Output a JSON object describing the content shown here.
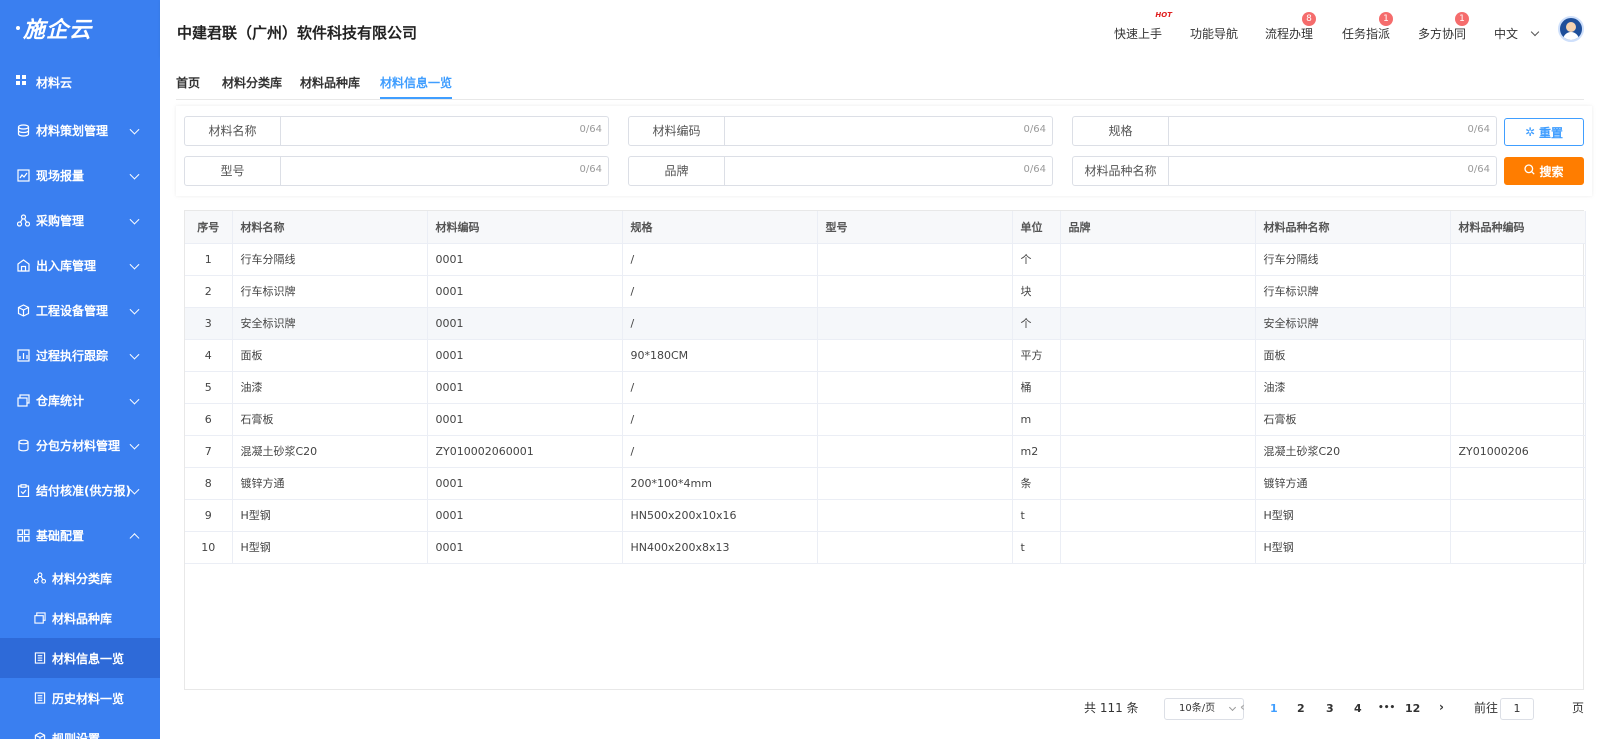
{
  "app": {
    "logo": "施企云"
  },
  "sidebar": {
    "root": "材料云",
    "items": [
      {
        "label": "材料策划管理",
        "icon": "database-icon"
      },
      {
        "label": "现场报量",
        "icon": "report-icon"
      },
      {
        "label": "采购管理",
        "icon": "network-icon"
      },
      {
        "label": "出入库管理",
        "icon": "warehouse-icon"
      },
      {
        "label": "工程设备管理",
        "icon": "cube-icon"
      },
      {
        "label": "过程执行跟踪",
        "icon": "chart-icon"
      },
      {
        "label": "仓库统计",
        "icon": "stack-icon"
      },
      {
        "label": "分包方材料管理",
        "icon": "coins-icon"
      },
      {
        "label": "结付核准(供方报)",
        "icon": "clipboard-icon"
      },
      {
        "label": "基础配置",
        "icon": "grid-icon"
      }
    ],
    "sub_items": [
      {
        "label": "材料分类库",
        "icon": "network-icon"
      },
      {
        "label": "材料品种库",
        "icon": "stack-icon"
      },
      {
        "label": "材料信息一览",
        "icon": "document-icon"
      },
      {
        "label": "历史材料一览",
        "icon": "document-icon"
      },
      {
        "label": "规则设置",
        "icon": "cube-icon"
      }
    ]
  },
  "header": {
    "company": "中建君联（广州）软件科技有限公司",
    "nav": [
      {
        "label": "快速上手",
        "badge": "HOT"
      },
      {
        "label": "功能导航",
        "badge": ""
      },
      {
        "label": "流程办理",
        "badge": "8"
      },
      {
        "label": "任务指派",
        "badge": "1"
      },
      {
        "label": "多方协同",
        "badge": "1"
      }
    ],
    "language": "中文"
  },
  "tabs": [
    "首页",
    "材料分类库",
    "材料品种库",
    "材料信息一览"
  ],
  "filters": [
    {
      "label": "材料名称",
      "value": "",
      "count": "0/64"
    },
    {
      "label": "材料编码",
      "value": "",
      "count": "0/64"
    },
    {
      "label": "规格",
      "value": "",
      "count": "0/64"
    },
    {
      "label": "型号",
      "value": "",
      "count": "0/64"
    },
    {
      "label": "品牌",
      "value": "",
      "count": "0/64"
    },
    {
      "label": "材料品种名称",
      "value": "",
      "count": "0/64"
    }
  ],
  "buttons": {
    "reset": "重置",
    "search": "搜索"
  },
  "table": {
    "columns": [
      "序号",
      "材料名称",
      "材料编码",
      "规格",
      "型号",
      "单位",
      "品牌",
      "材料品种名称",
      "材料品种编码"
    ],
    "rows": [
      [
        "1",
        "行车分隔线",
        "0001",
        "/",
        "",
        "个",
        "",
        "行车分隔线",
        ""
      ],
      [
        "2",
        "行车标识牌",
        "0001",
        "/",
        "",
        "块",
        "",
        "行车标识牌",
        ""
      ],
      [
        "3",
        "安全标识牌",
        "0001",
        "/",
        "",
        "个",
        "",
        "安全标识牌",
        ""
      ],
      [
        "4",
        "面板",
        "0001",
        "90*180CM",
        "",
        "平方",
        "",
        "面板",
        ""
      ],
      [
        "5",
        "油漆",
        "0001",
        "/",
        "",
        "桶",
        "",
        "油漆",
        ""
      ],
      [
        "6",
        "石膏板",
        "0001",
        "/",
        "",
        "m",
        "",
        "石膏板",
        ""
      ],
      [
        "7",
        "混凝土砂浆C20",
        "ZY010002060001",
        "/",
        "",
        "m2",
        "",
        "混凝土砂浆C20",
        "ZY01000206"
      ],
      [
        "8",
        "镀锌方通",
        "0001",
        "200*100*4mm",
        "",
        "条",
        "",
        "镀锌方通",
        ""
      ],
      [
        "9",
        "H型钢",
        "0001",
        "HN500x200x10x16",
        "",
        "t",
        "",
        "H型钢",
        ""
      ],
      [
        "10",
        "H型钢",
        "0001",
        "HN400x200x8x13",
        "",
        "t",
        "",
        "H型钢",
        ""
      ]
    ]
  },
  "pagination": {
    "total": "共 111 条",
    "page_size": "10条/页",
    "pages": [
      "1",
      "2",
      "3",
      "4",
      "•••",
      "12"
    ],
    "current": "1",
    "goto_label": "前往",
    "goto_value": "1",
    "page_suffix": "页"
  }
}
